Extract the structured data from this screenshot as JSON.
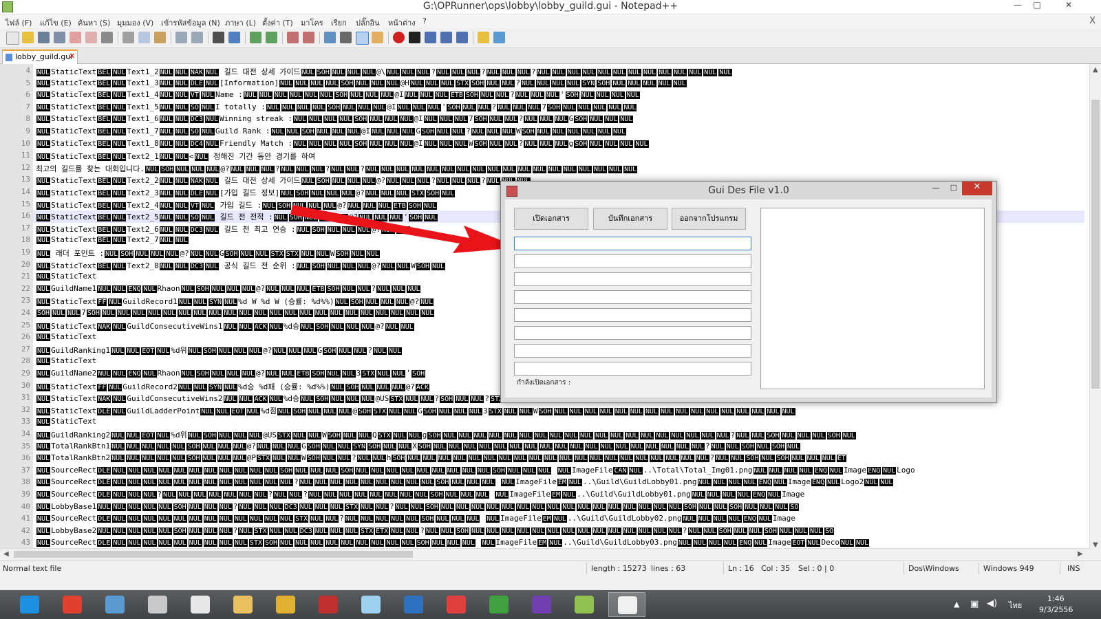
{
  "window": {
    "title": "G:\\OPRunner\\ops\\lobby\\lobby_guild.gui - Notepad++",
    "controls": {
      "minimize": "—",
      "maximize": "□",
      "close": "✕"
    }
  },
  "menu": {
    "items": [
      "ไฟล์ (F)",
      "แก้ไข (E)",
      "ค้นหา (S)",
      "มุมมอง (V)",
      "เข้ารหัสข้อมูล (N)",
      "ภาษา (L)",
      "ตั้งค่า (T)",
      "มาโคร",
      "เรียก",
      "ปลั๊กอิน",
      "หน้าต่าง",
      "?"
    ],
    "close": "X"
  },
  "toolbar": {
    "icons": [
      "new-file-icon",
      "open-file-icon",
      "save-icon",
      "save-all-icon",
      "close-icon",
      "close-all-icon",
      "print-icon",
      "cut-icon",
      "copy-icon",
      "paste-icon",
      "undo-icon",
      "redo-icon",
      "find-icon",
      "replace-icon",
      "zoom-in-icon",
      "zoom-out-icon",
      "sync-v-icon",
      "sync-h-icon",
      "wrap-icon",
      "show-all-chars-icon",
      "indent-guide-icon",
      "udl-icon",
      "record-macro-icon",
      "stop-macro-icon",
      "play-macro-icon",
      "run-macro-multiple-icon",
      "save-macro-icon",
      "open-folder-icon",
      "spell-check-icon"
    ],
    "colors": {
      "record": "#d02020",
      "accent": "#3c7fd6"
    }
  },
  "tab": {
    "label": "lobby_guild.gui",
    "close": "✕"
  },
  "editor": {
    "lines": [
      {
        "n": "4",
        "t": "NUL|StaticText|BEL|NUL|Text1_2|NUL|NUL|NAK|NUL| 길드 대전 상세 가이드|NUL|SOH|NUL|NUL|NUL|@\\|NUL|NUL|NUL|?|NUL|NUL|NUL|?|NUL|NUL|NUL|?|NUL|NUL|NUL|NUL|NUL|NUL|NUL|NUL|NUL|NUL|NUL|NUL|NUL"
      },
      {
        "n": "5",
        "t": "NUL|StaticText|BEL|NUL|Text1_3|NUL|NUL|DLE|NUL|[Information]|NUL|NUL|NUL|NUL|SOH|NUL|NUL|NUL|@H|NUL|NUL|NUL|STX|SOH|NUL|NUL|?|NUL|NUL|NUL|NUL|SYN|SOH|NUL|NUL|NUL|NUL|NUL"
      },
      {
        "n": "6",
        "t": "NUL|StaticText|BEL|NUL|Text1_4|NUL|NUL|VT|NUL|Name :|NUL|NUL|NUL|NUL|NUL|NUL|SOH|NUL|NUL|NUL|@I|NUL|NUL|NUL|ETB|SOH|NUL|NUL|?|NUL|NUL|NUL|'|SOH|NUL|NUL|NUL|NUL"
      },
      {
        "n": "7",
        "t": "NUL|StaticText|BEL|NUL|Text1_5|NUL|NUL|SO|NUL|I totally :|NUL|NUL|NUL|NUL|SOH|NUL|NUL|NUL|@I|NUL|NUL|NUL|'|SOH|NUL|NUL|?|NUL|NUL|NUL|7|SOH|NUL|NUL|NUL|NUL|NUL"
      },
      {
        "n": "8",
        "t": "NUL|StaticText|BEL|NUL|Text1_6|NUL|NUL|DC3|NUL|Winning streak :|NUL|NUL|NUL|NUL|SOH|NUL|NUL|NUL|@I|NUL|NUL|NUL|7|SOH|NUL|NUL|?|NUL|NUL|NUL|G|SOH|NUL|NUL|NUL"
      },
      {
        "n": "9",
        "t": "NUL|StaticText|BEL|NUL|Text1_7|NUL|NUL|SO|NUL|Guild Rank :|NUL|NUL|SOH|NUL|NUL|NUL|@I|NUL|NUL|NUL|G|SOH|NUL|NUL|?|NUL|NUL|NUL|W|SOH|NUL|NUL|NUL|NUL|NUL|NUL"
      },
      {
        "n": "10",
        "t": "NUL|StaticText|BEL|NUL|Text1_8|NUL|NUL|DC4|NUL|Friendly Match :|NUL|NUL|NUL|NUL|SOH|NUL|NUL|NUL|@I|NUL|NUL|NUL|W|SOH|NUL|NUL|?|NUL|NUL|NUL|g|SOH|NUL|NUL|NUL|NUL"
      },
      {
        "n": "11",
        "t": "NUL|StaticText|BEL|NUL|Text2_1|NUL|NUL|<|NUL| 정해진 기간 동안 경기를 하여"
      },
      {
        "n": "12",
        "t": " 최고의 길드를 찾는 대회입니다.|NUL|SOH|NUL|NUL|NUL|@?|NUL|NUL|NUL|?|NUL|NUL|NUL|?|NUL|NUL|?|NUL|NUL|NUL|NUL|NUL|NUL|NUL|NUL|NUL|NUL|NUL|NUL|NUL|NUL|NUL|NUL|NUL|NUL"
      },
      {
        "n": "13",
        "t": "NUL|StaticText|BEL|NUL|Text2_2|NUL|NUL|NAK|NUL| 길드 대전 상세 가이드|NUL|SOH|NUL|NUL|NUL|@?|NUL|NUL|NUL|?|NUL|NUL|NUL|?|NUL|NUL|NUL"
      },
      {
        "n": "14",
        "t": "NUL|StaticText|BEL|NUL|Text2_3|NUL|NUL|DLE|NUL|[가입 길드 정보]|NUL|SOH|NUL|NUL|NUL|@?|NUL|NUL|NUL|STX|SOH|NUL"
      },
      {
        "n": "15",
        "t": "NUL|StaticText|BEL|NUL|Text2_4|NUL|NUL|VT|NUL| 가입 길드 :|NUL|SOH|NUL|NUL|NUL|@?|NUL|NUL|NUL|ETB|SOH|NUL"
      },
      {
        "n": "16",
        "t": "NUL|StaticText|BEL|NUL|Text2_5|NUL|NUL|SO|NUL| 길드 전 전적 :|NUL|SOH|NUL|NUL|NUL|@?|NUL|NUL|NUL|'|SOH|NUL"
      },
      {
        "n": "17",
        "t": "NUL|StaticText|BEL|NUL|Text2_6|NUL|NUL|DC3|NUL| 길드 전 최고 연승 :|NUL|SOH|NUL|NUL|NUL|@?|NUL|NUL"
      },
      {
        "n": "18",
        "t": "NUL|StaticText|BEL|NUL|Text2_7|NUL|NUL"
      },
      {
        "n": "19",
        "t": "NUL| 래더 포인트 :|NUL|SOH|NUL|NUL|NUL|@?|NUL|NUL|G|SOH|NUL|NUL|STX|STX|NUL|NUL|W|SOH|NUL|NUL"
      },
      {
        "n": "20",
        "t": "NUL|StaticText|BEL|NUL|Text2_8|NUL|NUL|DC3|NUL| 공식 길드 전 순위 :|NUL|SOH|NUL|NUL|NUL|@?|NUL|NUL|W|SOH|NUL"
      },
      {
        "n": "21",
        "t": "NUL|StaticText"
      },
      {
        "n": "22",
        "t": "NUL|GuildName1|NUL|NUL|ENQ|NUL|Rhaon|NUL|SOH|NUL|NUL|NUL|@?|NUL|NUL|NUL|ETB|SOH|NUL|NUL|?|NUL|NUL|NUL"
      },
      {
        "n": "23",
        "t": "NUL|StaticText|FF|NUL|GuildRecord1|NUL|NUL|SYN|NUL|%d W %d W (승률: %d%%)|NUL|SOH|NUL|NUL|NUL|@?|NUL"
      },
      {
        "n": "24",
        "t": "SOH|NUL|NUL|7|SOH|NUL|NUL|NUL|NUL|NUL|NUL|NUL|NUL|NUL|NUL|NUL|NUL|NUL|NUL|NUL|NUL|NUL|NUL|NUL|NUL|NUL|NUL"
      },
      {
        "n": "25",
        "t": "NUL|StaticText|NAK|NUL|GuildConsecutiveWins1|NUL|NUL|ACK|NUL|%d승|NUL|SOH|NUL|NUL|NUL|@?|NUL|NUL"
      },
      {
        "n": "26",
        "t": "NUL|StaticText"
      },
      {
        "n": "27",
        "t": "NUL|GuildRanking1|NUL|NUL|EOT|NUL|%d위|NUL|SOH|NUL|NUL|NUL|@?|NUL|NUL|NUL|G|SOH|NUL|NUL|?|NUL|NUL"
      },
      {
        "n": "28",
        "t": "NUL|StaticText"
      },
      {
        "n": "29",
        "t": "NUL|GuildName2|NUL|NUL|ENQ|NUL|Rhaon|NUL|SOH|NUL|NUL|NUL|@?|NUL|NUL|ETB|SOH|NUL|NUL|3|STX|NUL|NUL|'|SOH"
      },
      {
        "n": "30",
        "t": "NUL|StaticText|FF|NUL|GuildRecord2|NUL|NUL|SYN|NUL|%d승 %d패 (승률: %d%%)|NUL|SOH|NUL|NUL|NUL|@?|ACK"
      },
      {
        "n": "31",
        "t": "NUL|StaticText|NAK|NUL|GuildConsecutiveWins2|NUL|NUL|ACK|NUL|%d승|NUL|SOH|NUL|NUL|NUL|@US|STX|NUL|NUL|?|SOH|NUL|NUL|?|STX|NUL|NUL|G|SOH|NUL|NUL|NUL|NUL|NUL|NUL|NUL|NUL|NUL|NUL|NUL|NUL|NUL|NUL|NUL|NUL"
      },
      {
        "n": "32",
        "t": "NUL|StaticText|DLE|NUL|GuildLadderPoint|NUL|NUL|EOT|NUL|%d점|NUL|SOH|NUL|NUL|NUL|@|SOH|STX|NUL|NUL|G|SOH|NUL|NUL|NUL|3|STX|NUL|NUL|W|SOH|NUL|NUL|NUL|NUL|NUL|NUL|NUL|NUL|NUL|NUL|NUL|NUL|NUL|NUL|NUL|NUL"
      },
      {
        "n": "33",
        "t": "NUL|StaticText"
      },
      {
        "n": "34",
        "t": "NUL|GuildRanking2|NUL|NUL|EOT|NUL|%d위|NUL|SOH|NUL|NUL|NUL|@US|STX|NUL|NUL|W|SOH|NUL|NUL|Q|STX|NUL|NUL|g|SOH|NUL|NUL|NUL|NUL|NUL|NUL|NUL|NUL|NUL|NUL|NUL|NUL|NUL|NUL|NUL|NUL|NUL|NUL|NUL|?|NUL|NUL|SOH|NUL|NUL|NUL|SOH|NUL"
      },
      {
        "n": "35",
        "t": "NUL|TotalRankBtn1|NUL|NUL|NUL|NUL|NUL|SOH|NUL|NUL|NUL|@?|NUL|NUL|NUL|G|SOH|NUL|NUL|SYN|SOH|NUL|NUL|X|SOH|NUL|NUL|NUL|NUL|NUL|NUL|NUL|NUL|NUL|NUL|NUL|NUL|NUL|NUL|NUL|NUL|NUL|NUL|?|NUL|NUL|SOH|NUL|SOH|NUL"
      },
      {
        "n": "36",
        "t": "NUL|TotalRankBtn2|NUL|NUL|NUL|NUL|NUL|SOH|NUL|NUL|NUL|@P|STX|NUL|NUL|W|SOH|NUL|NUL|?|NUL|NUL|h|SOH|NUL|NUL|NUL|NUL|NUL|NUL|NUL|NUL|NUL|NUL|NUL|NUL|NUL|NUL|NUL|NUL|NUL|NUL|NUL|NUL|?|NUL|NUL|SOH|NUL|SOH|NUL|NUL|NUL|ET"
      },
      {
        "n": "37",
        "t": "NUL|SourceRect|DLE|NUL|NUL|NUL|NUL|NUL|NUL|NUL|NUL|NUL|NUL|NUL|SOH|NUL|NUL|NUL|SOH|NUL|NUL|NUL|NUL|NUL|NUL|NUL|NUL|NUL|SOH|NUL|NUL|NUL|    |NUL|ImageFile|CAN|NUL|..\\Total\\Total_Img01.png|NUL|NUL|NUL|NUL|ENQ|NUL|Image|ENQ|NUL|Logo"
      },
      {
        "n": "38",
        "t": "NUL|SourceRect|DLE|NUL|NUL|NUL|NUL|NUL|NUL|NUL|NUL|NUL|NUL|NUL|NUL|?|NUL|NUL|NUL|NUL|NUL|NUL|NUL|NUL|NUL|SOH|NUL|NUL|NUL| |NUL|ImageFile|EM|NUL|..\\Guild\\GuildLobby01.png|NUL|NUL|NUL|NUL|ENQ|NUL|Image|ENQ|NUL|Logo2|NUL|NUL"
      },
      {
        "n": "39",
        "t": "NUL|SourceRect|DLE|NUL|NUL|NUL|?|NUL|NUL|NUL|NUL|NUL|NUL|NUL|?|NUL|NUL|?|NUL|NUL|NUL|NUL|NUL|NUL|NUL|NUL|SOH|NUL|NUL|NUL|    |NUL|ImageFile|EM|NUL|..\\Guild\\GuildLobby01.png|NUL|NUL|NUL|NUL|ENQ|NUL|Image"
      },
      {
        "n": "40",
        "t": "NUL|LobbyBase1|NUL|NUL|NUL|NUL|NUL|SOH|NUL|NUL|NUL|?|NUL|NUL|NUL|DC3|NUL|NUL|NUL|STX|NUL|NUL|?|NUL|NUL|SOH|NUL|NUL|NUL|NUL|NUL|NUL|NUL|NUL|NUL|NUL|NUL|NUL|NUL|NUL|NUL|NUL|SOH|NUL|NUL|SOH|NUL|NUL|NUL|SO"
      },
      {
        "n": "41",
        "t": "NUL|SourceRect|DLE|NUL|NUL|NUL|NUL|NUL|NUL|NUL|NUL|NUL|NUL|NUL|NUL|STX|NUL|NUL|?|NUL|NUL|NUL|NUL|NUL|SOH|NUL|NUL|NUL|  |NUL|ImageFile|EM|NUL|..\\Guild\\GuildLobby02.png|NUL|NUL|NUL|NUL|ENQ|NUL|Image"
      },
      {
        "n": "42",
        "t": "NUL|LobbyBase2|NUL|NUL|NUL|NUL|NUL|SOH|NUL|NUL|NUL|?|NUL|STX|NUL|NUL|DC3|NUL|NUL|NUL|STX|ETX|NUL|NUL|?|NUL|NUL|SOH|NUL|NUL|NUL|NUL|NUL|NUL|NUL|NUL|NUL|NUL|NUL|NUL|NUL|NUL|?|NUL|NUL|SOH|NUL|NUL|SOH|NUL|NUL|NUL|SO"
      },
      {
        "n": "43",
        "t": "NUL|SourceRect|DLE|NUL|NUL|NUL|NUL|NUL|NUL|NUL|NUL|NUL|STX|SOH|NUL|NUL|NUL|NUL|NUL|NUL|NUL|NUL|NUL|SOH|NUL|NUL|NUL|  |NUL|ImageFile|EM|NUL|..\\Guild\\GuildLobby03.png|NUL|NUL|NUL|NUL|ENQ|NUL|Image|EOT|NUL|Deco|NUL|NUL"
      }
    ]
  },
  "status": {
    "file_type": "Normal text file",
    "length": "length : 15273",
    "lines": "lines : 63",
    "ln": "Ln : 16",
    "col": "Col : 35",
    "sel": "Sel : 0 | 0",
    "eol": "Dos\\Windows",
    "encoding": "Windows 949",
    "mode": "INS"
  },
  "dialog": {
    "title": "Gui Des File v1.0",
    "controls": {
      "minimize": "—",
      "maximize": "□",
      "close": "✕"
    },
    "buttons": {
      "open": "เปิดเอกสาร",
      "save": "บันทึกเอกสาร",
      "exit": "ออกจากโปรแกรม"
    },
    "fields": [
      "",
      "",
      "",
      "",
      "",
      "",
      "",
      ""
    ],
    "status": "กำลังเปิดเอกสาร :",
    "arrow_color": "#e8141a"
  },
  "taskbar": {
    "apps": [
      {
        "name": "ie-icon",
        "color": "#1e90e0"
      },
      {
        "name": "chrome-icon",
        "color": "#e04030"
      },
      {
        "name": "users-icon",
        "color": "#5a9ad0"
      },
      {
        "name": "cabinet-icon",
        "color": "#c9c9c9"
      },
      {
        "name": "eye-app-icon",
        "color": "#e8e8e8"
      },
      {
        "name": "explorer-icon",
        "color": "#e8c060"
      },
      {
        "name": "hxd-icon",
        "color": "#e0b030"
      },
      {
        "name": "cheat-engine-icon",
        "color": "#c03030"
      },
      {
        "name": "notepad-icon",
        "color": "#a0d0f0"
      },
      {
        "name": "remote-desktop-icon",
        "color": "#3070c0"
      },
      {
        "name": "star-app-icon",
        "color": "#e04040"
      },
      {
        "name": "python-icon",
        "color": "#40a040"
      },
      {
        "name": "visual-studio-icon",
        "color": "#7040b0"
      },
      {
        "name": "notepadpp-icon",
        "color": "#90c050"
      },
      {
        "name": "mfc-app-icon",
        "color": "#f0f0f0"
      }
    ],
    "language": "ไทย",
    "time": "1:46",
    "date": "9/3/2556"
  }
}
